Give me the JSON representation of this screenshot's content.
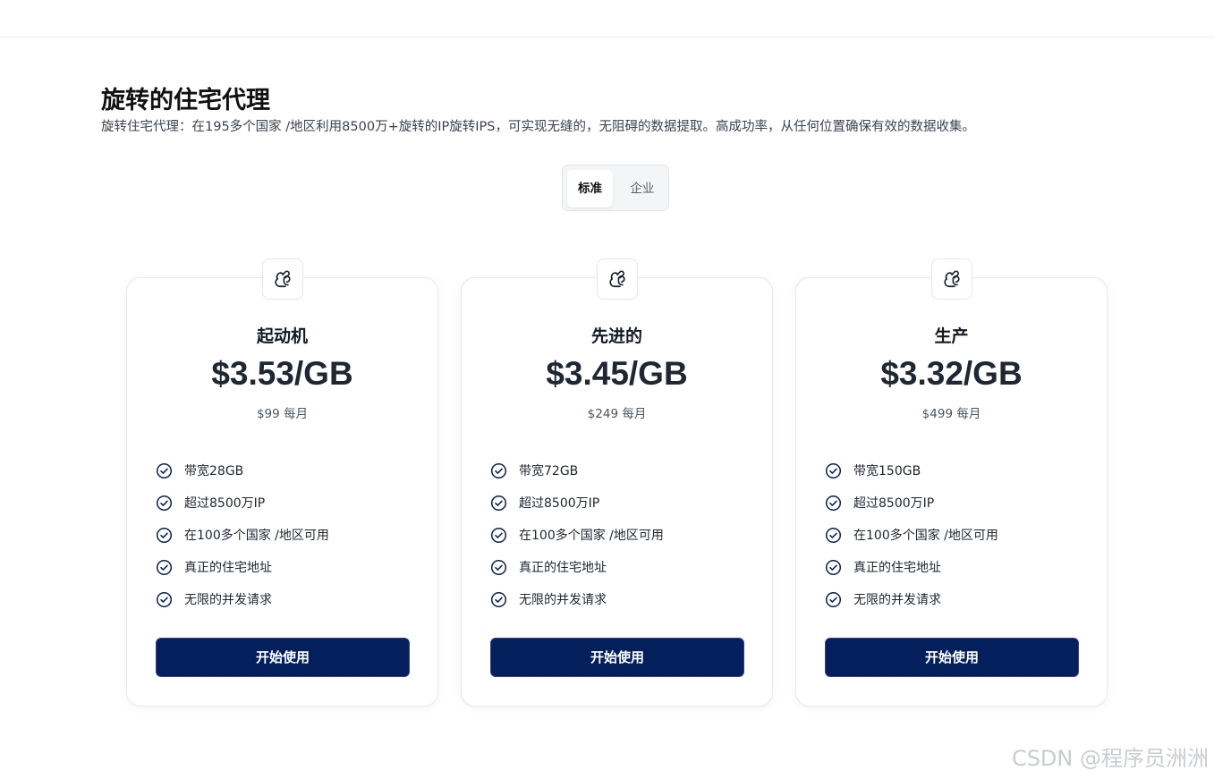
{
  "header": {
    "title": "旋转的住宅代理",
    "subtitle": "旋转住宅代理：在195多个国家 /地区利用8500万+旋转的IP旋转IPS，可实现无缝的，无阻碍的数据提取。高成功率，从任何位置确保有效的数据收集。"
  },
  "toggle": {
    "options": [
      {
        "label": "标准",
        "active": true
      },
      {
        "label": "企业",
        "active": false
      }
    ]
  },
  "plans": [
    {
      "icon": "squirrel-icon",
      "name": "起动机",
      "price": "$3.53/GB",
      "monthly": "$99 每月",
      "features": [
        "带宽28GB",
        "超过8500万IP",
        "在100多个国家 /地区可用",
        "真正的住宅地址",
        "无限的并发请求"
      ],
      "button_label": "开始使用"
    },
    {
      "icon": "squirrel-icon",
      "name": "先进的",
      "price": "$3.45/GB",
      "monthly": "$249 每月",
      "features": [
        "带宽72GB",
        "超过8500万IP",
        "在100多个国家 /地区可用",
        "真正的住宅地址",
        "无限的并发请求"
      ],
      "button_label": "开始使用"
    },
    {
      "icon": "squirrel-icon",
      "name": "生产",
      "price": "$3.32/GB",
      "monthly": "$499 每月",
      "features": [
        "带宽150GB",
        "超过8500万IP",
        "在100多个国家 /地区可用",
        "真正的住宅地址",
        "无限的并发请求"
      ],
      "button_label": "开始使用"
    }
  ],
  "watermark": "CSDN @程序员洲洲",
  "colors": {
    "button_bg": "#031f5c",
    "check_icon": "#0b2150",
    "price_text": "#1f2733"
  }
}
